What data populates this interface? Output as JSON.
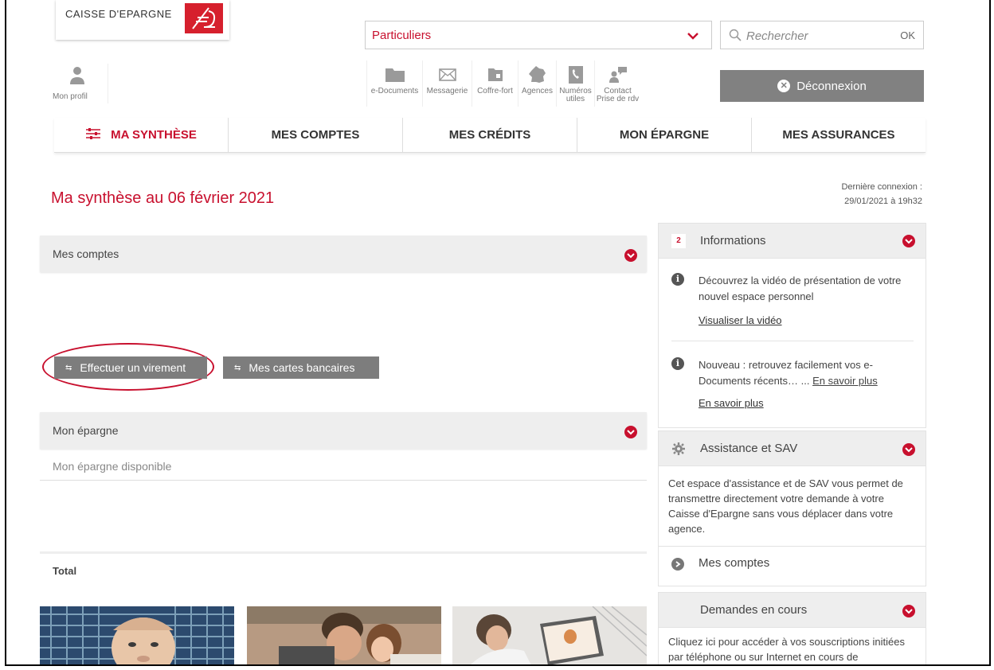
{
  "brand": {
    "name": "CAISSE D'EPARGNE",
    "logo_icon": "squirrel-logo-icon",
    "color": "#d6202d"
  },
  "segment_select": {
    "value": "Particuliers"
  },
  "search": {
    "placeholder": "Rechercher",
    "submit_label": "OK"
  },
  "profile": {
    "label": "Mon profil"
  },
  "tools": [
    {
      "label": "e-Documents",
      "icon": "folder-icon"
    },
    {
      "label": "Messagerie",
      "icon": "envelope-icon"
    },
    {
      "label": "Coffre-fort",
      "icon": "safe-icon"
    },
    {
      "label": "Agences",
      "icon": "france-map-icon"
    },
    {
      "label1": "Numéros",
      "label2": "utiles",
      "icon": "phone-icon"
    },
    {
      "label1": "Contact",
      "label2": "Prise de rdv",
      "icon": "contact-icon"
    }
  ],
  "logout_label": "Déconnexion",
  "nav": {
    "tabs": [
      {
        "label": "MA SYNTHÈSE",
        "active": true
      },
      {
        "label": "MES COMPTES"
      },
      {
        "label": "MES CRÉDITS"
      },
      {
        "label": "MON ÉPARGNE"
      },
      {
        "label": "MES ASSURANCES"
      }
    ]
  },
  "page": {
    "title": "Ma synthèse au 06 février 2021",
    "last_connection_label": "Dernière connexion :",
    "last_connection_value": "29/01/2021 à 19h32"
  },
  "left": {
    "accounts_title": "Mes comptes",
    "transfer_button": "Effectuer un virement",
    "cards_button": "Mes cartes bancaires",
    "savings_title": "Mon épargne",
    "savings_available": "Mon épargne disponible",
    "total_label": "Total"
  },
  "informations": {
    "count": "2",
    "title": "Informations",
    "items": [
      {
        "text": "Découvrez la vidéo de présentation de votre nouvel espace personnel",
        "link": "Visualiser la vidéo"
      },
      {
        "text": "Nouveau : retrouvez facilement vos e-Documents récents… ...",
        "inline_link": "En savoir plus",
        "link": "En savoir plus"
      }
    ]
  },
  "assistance": {
    "title": "Assistance et SAV",
    "body": "Cet espace d'assistance et de SAV vous permet de transmettre directement votre demande à votre Caisse d'Epargne sans vous déplacer dans votre agence.",
    "link": "Mes comptes"
  },
  "requests": {
    "title": "Demandes en cours",
    "body": "Cliquez ici pour accéder à vos souscriptions initiées par téléphone ou sur Internet en cours de"
  },
  "colors": {
    "accent": "#c8102e",
    "grey_button": "#7d7d7d",
    "panel": "#eeeeee"
  }
}
